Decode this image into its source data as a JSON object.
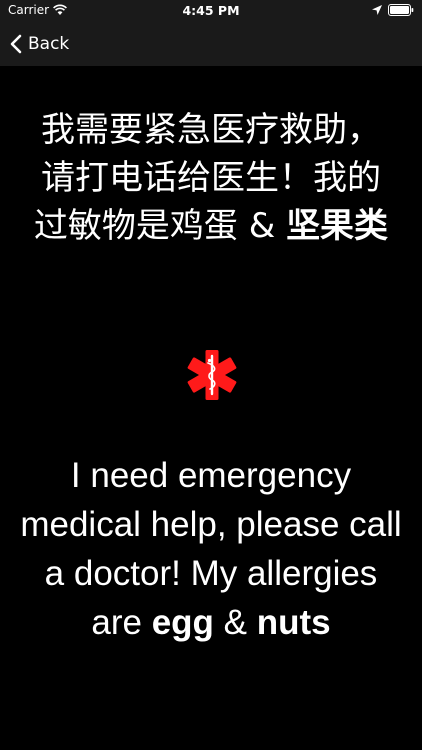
{
  "status_bar": {
    "carrier": "Carrier",
    "time": "4:45 PM",
    "icons": [
      "wifi-icon",
      "location-icon",
      "battery-icon"
    ]
  },
  "nav": {
    "back_label": "Back",
    "icon": "chevron-left-icon"
  },
  "message_zh": {
    "prefix": "我需要紧急医疗救助，请打电话给医生！我的过敏物是鸡蛋 & ",
    "allergen": "坚果类"
  },
  "medical_symbol": {
    "icon": "star-of-life-icon",
    "color": "#ff1a1a"
  },
  "message_en": {
    "prefix": "I need emergency medical help, please call a doctor! My allergies are ",
    "allergen_1": "egg",
    "connector": " & ",
    "allergen_2": "nuts"
  },
  "colors": {
    "background": "#000000",
    "bar": "#1a1a1a",
    "text": "#ffffff",
    "accent": "#ff1a1a"
  }
}
